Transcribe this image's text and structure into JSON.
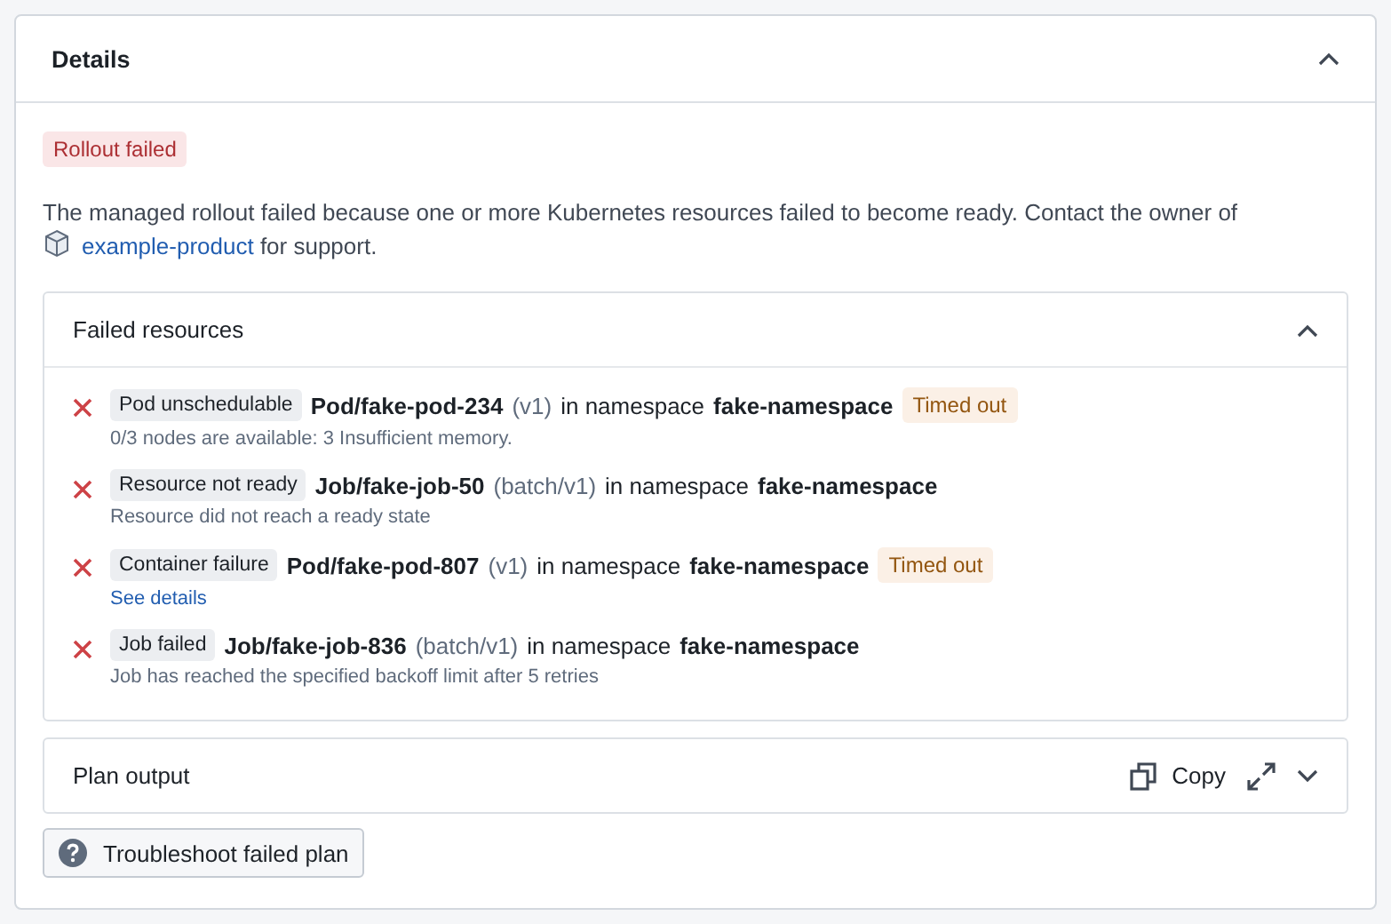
{
  "details": {
    "title": "Details",
    "expanded": true,
    "status_tag": "Rollout failed",
    "message": "The managed rollout failed because one or more Kubernetes resources failed to become ready. Contact the owner of",
    "link": "example-product",
    "message_end": "for support."
  },
  "failed_resources": {
    "title": "Failed resources",
    "expanded": true,
    "items": [
      {
        "reason": "Pod unschedulable",
        "resource": "Pod/fake-pod-234",
        "version": "(v1)",
        "connector": "in namespace",
        "namespace": "fake-namespace",
        "tag": "Timed out",
        "detail": "0/3 nodes are available: 3 Insufficient memory.",
        "kind": "text"
      },
      {
        "reason": "Resource not ready",
        "resource": "Job/fake-job-50",
        "version": "(batch/v1)",
        "connector": "in namespace",
        "namespace": "fake-namespace",
        "detail": "Resource did not reach a ready state",
        "kind": "text"
      },
      {
        "reason": "Container failure",
        "resource": "Pod/fake-pod-807",
        "version": "(v1)",
        "connector": "in namespace",
        "namespace": "fake-namespace",
        "tag": "Timed out",
        "detail": "See details",
        "kind": "link"
      },
      {
        "reason": "Job failed",
        "resource": "Job/fake-job-836",
        "version": "(batch/v1)",
        "connector": "in namespace",
        "namespace": "fake-namespace",
        "detail": "Job has reached the specified backoff limit after 5 retries",
        "kind": "text"
      }
    ]
  },
  "plan_output": {
    "title": "Plan output",
    "expanded": false,
    "copy_label": "Copy"
  },
  "troubleshoot_button": "Troubleshoot failed plan"
}
